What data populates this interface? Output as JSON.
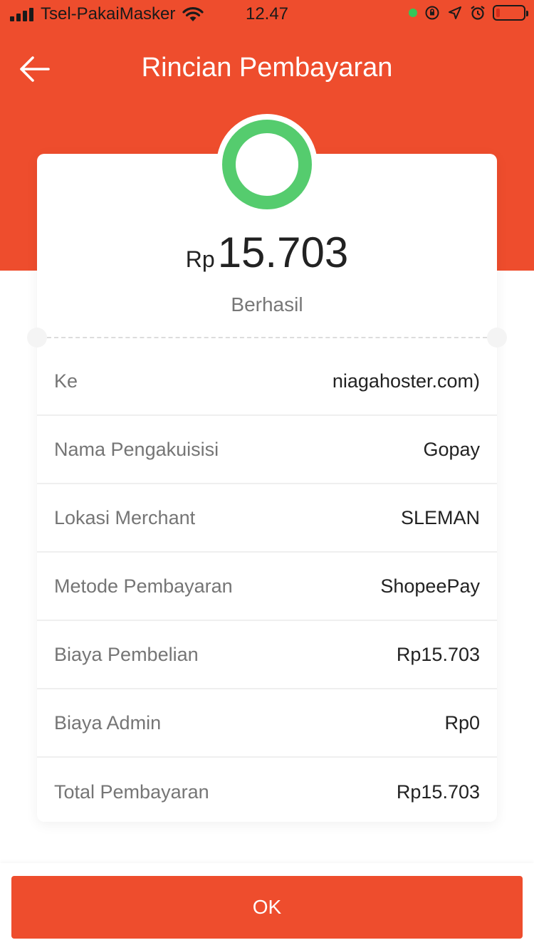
{
  "status_bar": {
    "carrier": "Tsel-PakaiMasker",
    "time": "12.47",
    "battery_level": 0.15
  },
  "header": {
    "title": "Rincian Pembayaran"
  },
  "summary": {
    "currency": "Rp",
    "amount": "15.703",
    "status": "Berhasil",
    "status_color": "#55cc6e"
  },
  "details": [
    {
      "label": "Ke",
      "value": "niagahoster.com)"
    },
    {
      "label": "Nama Pengakuisisi",
      "value": "Gopay"
    },
    {
      "label": "Lokasi Merchant",
      "value": "SLEMAN"
    },
    {
      "label": "Metode Pembayaran",
      "value": "ShopeePay"
    },
    {
      "label": "Biaya Pembelian",
      "value": "Rp15.703"
    },
    {
      "label": "Biaya Admin",
      "value": "Rp0"
    },
    {
      "label": "Total Pembayaran",
      "value": "Rp15.703"
    }
  ],
  "footer": {
    "ok_label": "OK"
  },
  "colors": {
    "brand": "#ee4d2d",
    "success": "#55cc6e"
  }
}
